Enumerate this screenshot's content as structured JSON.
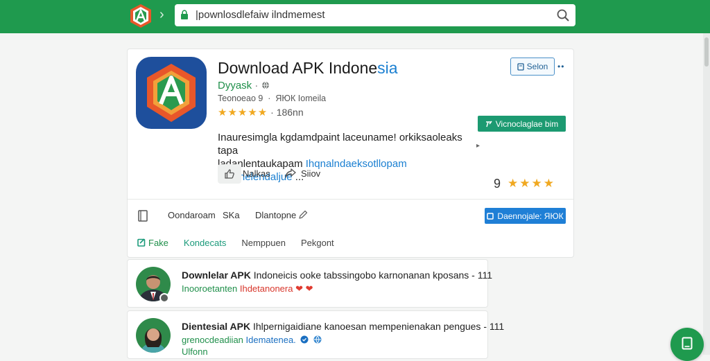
{
  "browser": {
    "url": "|pownlosdlefaiw ilndmemest"
  },
  "app": {
    "title_main": "Download APK Indone",
    "title_tail": "sia",
    "developer": "Dyyask",
    "developer_sep": " · ",
    "meta": "Teonoeao 9  ·  ЯЮК Iomeila",
    "stars": "★★★★★",
    "rating_text": " · 186nn",
    "follow_label": "Selon",
    "green_button_label": "Vicnoclaglae bim",
    "description_line1": "Inauresimgla kgdamdpaint laceuname! orkiksaoleaks tapa",
    "description_line2_plain": "ladanlentaukapam ",
    "description_line2_link": "Ihqnalndaeksotllopam Agntnelendaljue",
    "description_ellipsis": " ...",
    "like_label": "Nalkas",
    "share_label": "Siiov",
    "score": "9",
    "score_stars": "★★★★"
  },
  "actions": {
    "item1": "Oondaroam",
    "item2": "SKa",
    "item3": "Dlantopne",
    "download_label": "Daennojale: ЯЮК"
  },
  "tabs": [
    {
      "label": "Fake"
    },
    {
      "label": "Kondecats"
    },
    {
      "label": "Nemppuen"
    },
    {
      "label": "Pekgont"
    }
  ],
  "comments": [
    {
      "title_bold": "Downlelar APK",
      "title_rest": " Indoneicis ooke tabssingobo karnonanan kposans - 111",
      "sub_green": "Inooroetanten",
      "sub_red": " Ihdetanonera"
    },
    {
      "title_bold": "Dientesial APK",
      "title_rest": " Ihlpernigaidiane kanoesan mempenienakan pengues - 111",
      "sub_green": "grenocdeadiian",
      "sub_blue": " Idematenea.",
      "extra": "Ulfonn"
    }
  ],
  "colors": {
    "brand_green": "#1f9a4e",
    "link_blue": "#1a7fd1",
    "star": "#f0a820",
    "download_blue": "#1f7fd6",
    "teal_button": "#1c9a71"
  }
}
